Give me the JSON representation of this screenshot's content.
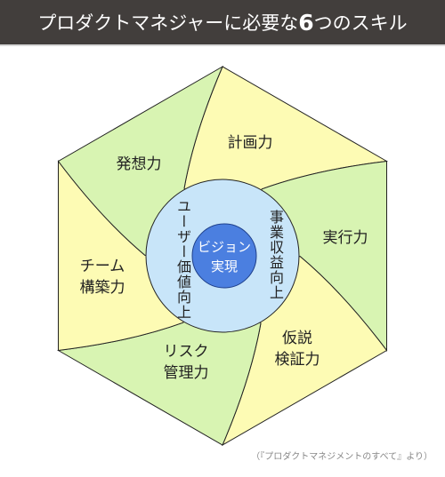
{
  "header": {
    "title_before": "プロダクトマネジャーに必要な",
    "title_number": "6",
    "title_after": "つのスキル"
  },
  "colors": {
    "green": "#d8f4b2",
    "yellow": "#fdfbb4",
    "outer_circle": "#c8e5f9",
    "core_circle": "#4b7fe0",
    "header_bg": "#423e3c"
  },
  "skills": [
    {
      "line1": "計画力",
      "line2": "",
      "color": "yellow"
    },
    {
      "line1": "実行力",
      "line2": "",
      "color": "green"
    },
    {
      "line1": "仮説",
      "line2": "検証力",
      "color": "yellow"
    },
    {
      "line1": "リスク",
      "line2": "管理力",
      "color": "green"
    },
    {
      "line1": "チーム",
      "line2": "構築力",
      "color": "yellow"
    },
    {
      "line1": "発想力",
      "line2": "",
      "color": "green"
    }
  ],
  "ring": {
    "left": "ユーザー価値向上",
    "right": "事業収益向上"
  },
  "core": {
    "line1": "ビジョン",
    "line2": "実現"
  },
  "caption": "（『プロダクトマネジメントのすべて』より）"
}
